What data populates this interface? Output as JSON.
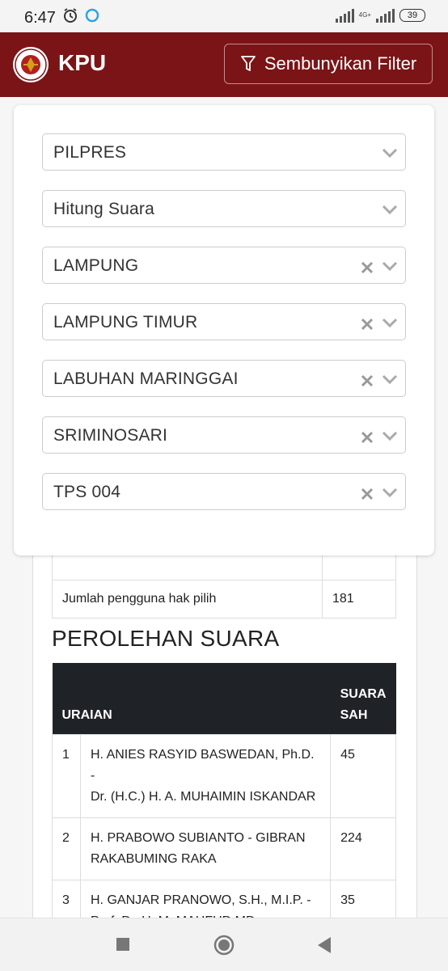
{
  "status_bar": {
    "time": "6:47",
    "network": "4G+",
    "battery": "39"
  },
  "header": {
    "brand": "KPU",
    "filter_button_label": "Sembunyikan Filter"
  },
  "filters": [
    {
      "value": "PILPRES",
      "clearable": false
    },
    {
      "value": "Hitung Suara",
      "clearable": false
    },
    {
      "value": "LAMPUNG",
      "clearable": true
    },
    {
      "value": "LAMPUNG TIMUR",
      "clearable": true
    },
    {
      "value": "LABUHAN MARINGGAI",
      "clearable": true
    },
    {
      "value": "SRIMINOSARI",
      "clearable": true
    },
    {
      "value": "TPS 004",
      "clearable": true
    }
  ],
  "summary_table": {
    "rows": [
      {
        "label": "",
        "value": ""
      },
      {
        "label": "Jumlah pengguna hak pilih",
        "value": "181"
      }
    ]
  },
  "votes": {
    "title": "PEROLEHAN SUARA",
    "columns": {
      "description": "URAIAN",
      "valid_votes_line1": "SUARA",
      "valid_votes_line2": "SAH"
    },
    "rows": [
      {
        "no": "1",
        "line1": "H. ANIES RASYID BASWEDAN, Ph.D. -",
        "line2": "Dr. (H.C.) H. A. MUHAIMIN ISKANDAR",
        "votes": "45"
      },
      {
        "no": "2",
        "line1": "H. PRABOWO SUBIANTO - GIBRAN",
        "line2": "RAKABUMING RAKA",
        "votes": "224"
      },
      {
        "no": "3",
        "line1": "H. GANJAR PRANOWO, S.H., M.I.P. -",
        "line2": "Prof. Dr. H. M. MAHFUD MD",
        "votes": "35"
      }
    ]
  },
  "colors": {
    "header_bg": "#7b1416",
    "table_header_bg": "#1f2227"
  }
}
